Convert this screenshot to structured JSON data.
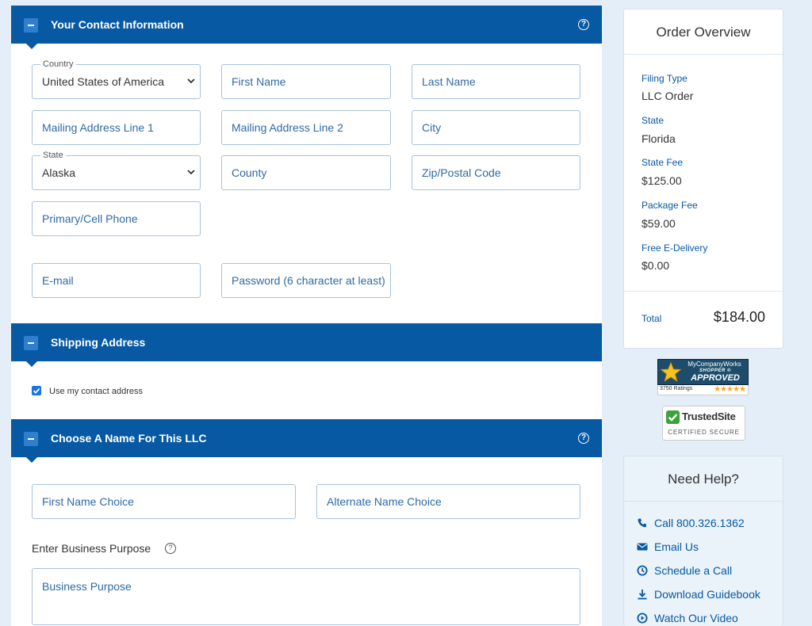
{
  "contact": {
    "title": "Your Contact Information",
    "country_legend": "Country",
    "country_value": "United States of America",
    "first_name": "First Name",
    "last_name": "Last Name",
    "address1": "Mailing Address Line 1",
    "address2": "Mailing Address Line 2",
    "city": "City",
    "state_legend": "State",
    "state_value": "Alaska",
    "county": "County",
    "zip": "Zip/Postal Code",
    "phone": "Primary/Cell Phone",
    "email": "E-mail",
    "password": "Password (6 character at least)"
  },
  "shipping": {
    "title": "Shipping Address",
    "use_contact_label": "Use my contact address",
    "use_contact_checked": true
  },
  "llc_name": {
    "title": "Choose A Name For This LLC",
    "first_choice": "First Name Choice",
    "alternate_choice": "Alternate Name Choice",
    "purpose_label": "Enter Business Purpose",
    "purpose_placeholder": "Business Purpose"
  },
  "order": {
    "title": "Order Overview",
    "items": [
      {
        "label": "Filing Type",
        "value": "LLC Order"
      },
      {
        "label": "State",
        "value": "Florida"
      },
      {
        "label": "State Fee",
        "value": "$125.00"
      },
      {
        "label": "Package Fee",
        "value": "$59.00"
      },
      {
        "label": "Free E-Delivery",
        "value": "$0.00"
      }
    ],
    "total_label": "Total",
    "total_value": "$184.00"
  },
  "badges": {
    "shopper_brand": "MyCompanyWorks",
    "shopper_line1": "SHOPPER ®",
    "shopper_line2": "APPROVED",
    "shopper_ratings": "3750 Ratings",
    "shopper_stars": "★★★★★",
    "trusted_name": "TrustedSite",
    "trusted_cert": "CERTIFIED SECURE"
  },
  "help": {
    "title": "Need Help?",
    "items": [
      {
        "label": "Call 800.326.1362",
        "icon": "phone-icon"
      },
      {
        "label": "Email Us",
        "icon": "envelope-icon"
      },
      {
        "label": "Schedule a Call",
        "icon": "clock-icon"
      },
      {
        "label": "Download Guidebook",
        "icon": "download-icon"
      },
      {
        "label": "Watch Our Video",
        "icon": "play-circle-icon"
      }
    ]
  },
  "colors": {
    "header_blue": "#0759a3",
    "page_bg": "#e3eef9",
    "link_blue": "#0759a3"
  }
}
